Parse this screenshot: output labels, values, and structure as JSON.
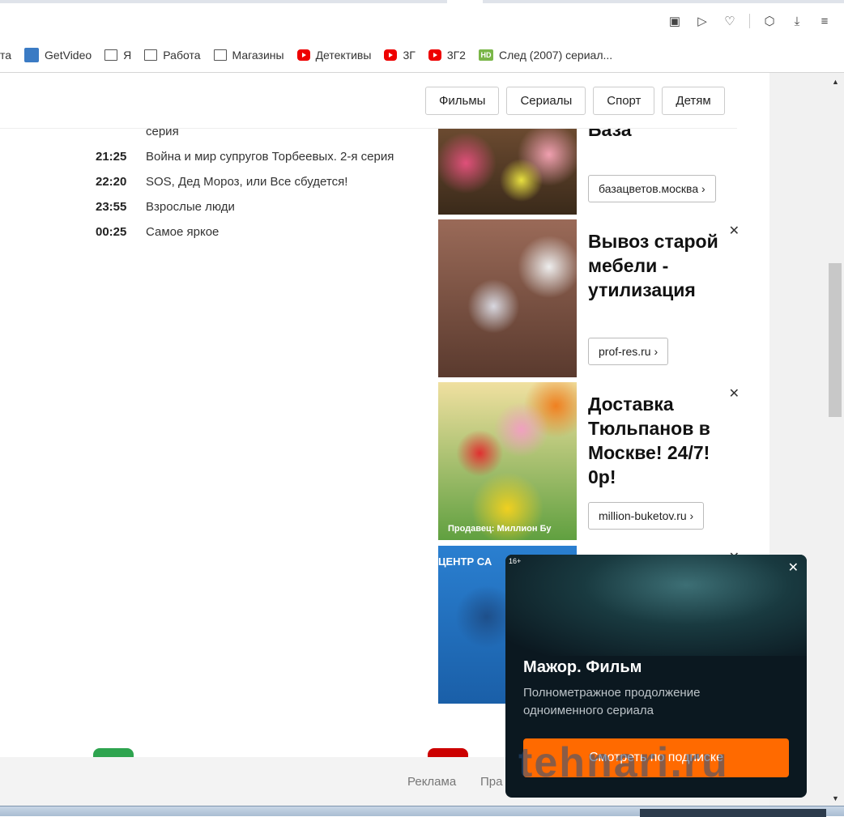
{
  "toolbar": {
    "icons": [
      "camera-icon",
      "send-icon",
      "heart-icon",
      "cube-icon",
      "download-icon",
      "settings-sliders-icon"
    ]
  },
  "bookmarks": [
    {
      "label": "та",
      "icon": "none"
    },
    {
      "label": "GetVideo",
      "icon": "getvideo-icon"
    },
    {
      "label": "Я",
      "icon": "folder-icon"
    },
    {
      "label": "Работа",
      "icon": "folder-icon"
    },
    {
      "label": "Магазины",
      "icon": "folder-icon"
    },
    {
      "label": "Детективы",
      "icon": "youtube-icon"
    },
    {
      "label": "3Г",
      "icon": "youtube-icon"
    },
    {
      "label": "3Г2",
      "icon": "youtube-icon"
    },
    {
      "label": "След (2007) сериал...",
      "icon": "hd-icon"
    }
  ],
  "nav": [
    "Фильмы",
    "Сериалы",
    "Спорт",
    "Детям"
  ],
  "schedule": [
    {
      "time": "",
      "title": "серия"
    },
    {
      "time": "21:25",
      "title": "Война и мир супругов Торбеевых. 2-я серия"
    },
    {
      "time": "22:20",
      "title": "SOS, Дед Мороз, или Все сбудется!"
    },
    {
      "time": "23:55",
      "title": "Взрослые люди"
    },
    {
      "time": "00:25",
      "title": "Самое яркое"
    }
  ],
  "ads": [
    {
      "title": "База",
      "link": "базацветов.москва ›"
    },
    {
      "title": "Вывоз старой мебели - утилизация",
      "link": "prof-res.ru ›"
    },
    {
      "title": "Доставка Тюльпанов в Москве! 24/7! 0р!",
      "link": "million-buketov.ru ›",
      "seller": "Продавец: Миллион Бу"
    },
    {
      "image_text": "ЦЕНТР СА"
    }
  ],
  "footer": {
    "ads": "Реклама",
    "other": "Пра"
  },
  "popup": {
    "age": "16+",
    "title": "Мажор. Фильм",
    "desc": "Полнометражное продолжение одноименного сериала",
    "cta": "Смотреть по подписке"
  },
  "watermark": "tehnari.ru",
  "colors": {
    "cta": "#ff6a00",
    "popup_bg": "#0b1820"
  }
}
